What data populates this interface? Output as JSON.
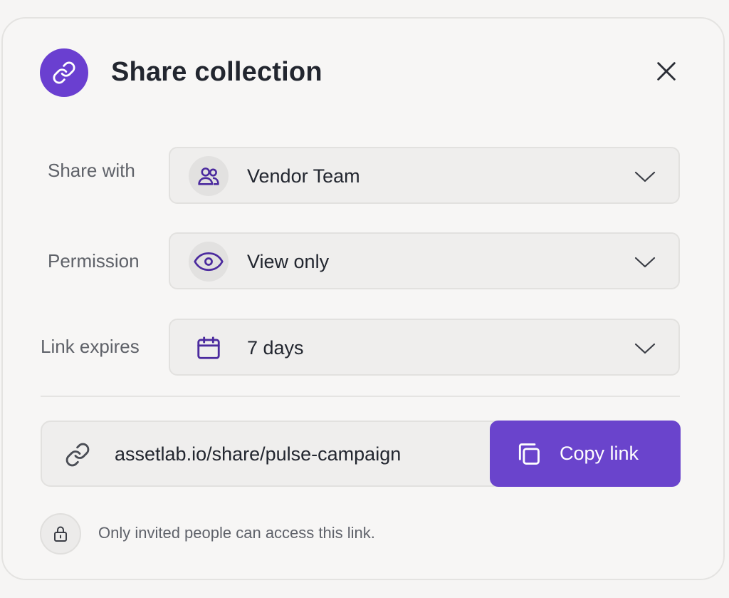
{
  "dialog": {
    "title": "Share collection",
    "header_icon": "link-icon",
    "close_icon": "close-icon",
    "accent_color": "#6a44cc"
  },
  "fields": {
    "share_with": {
      "label": "Share with",
      "value": "Vendor Team",
      "icon": "users-icon"
    },
    "permission": {
      "label": "Permission",
      "value": "View only",
      "icon": "eye-icon"
    },
    "link_expires": {
      "label": "Link expires",
      "value": "7 days",
      "icon": "calendar-icon"
    }
  },
  "link": {
    "url": "assetlab.io/share/pulse-campaign",
    "icon": "link-icon",
    "copy_label": "Copy link",
    "copy_icon": "copy-icon"
  },
  "footer": {
    "note": "Only invited people can access this link.",
    "icon": "lock-icon"
  }
}
